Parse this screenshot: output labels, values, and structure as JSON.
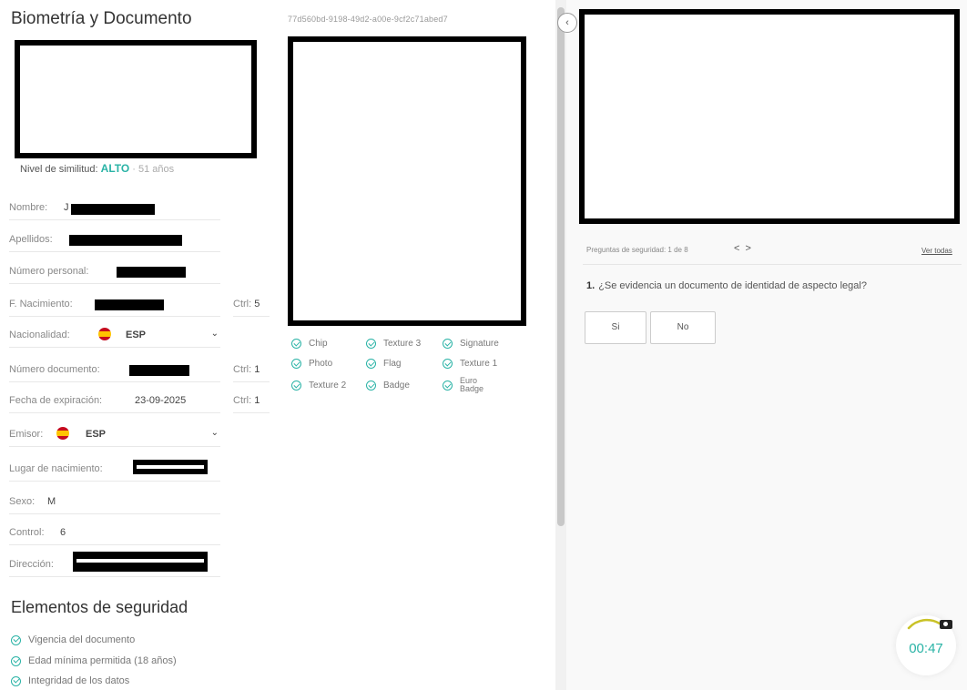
{
  "header": {
    "title": "Biometría y Documento",
    "document_id": "77d560bd-9198-49d2-a00e-9cf2c71abed7"
  },
  "biometry": {
    "similarity_label": "Nivel de similitud:",
    "similarity_level": "ALTO",
    "age": "· 51 años"
  },
  "fields": {
    "nombre_label": "Nombre:",
    "nombre_value": "J",
    "apellidos_label": "Apellidos:",
    "numero_personal_label": "Número personal:",
    "f_nacimiento_label": "F. Nacimiento:",
    "f_nacimiento_ctrl_label": "Ctrl:",
    "f_nacimiento_ctrl": "5",
    "nacionalidad_label": "Nacionalidad:",
    "nacionalidad_value": "ESP",
    "numero_documento_label": "Número documento:",
    "numero_documento_ctrl_label": "Ctrl:",
    "numero_documento_ctrl": "1",
    "fecha_expiracion_label": "Fecha de expiración:",
    "fecha_expiracion_value": "23-09-2025",
    "fecha_expiracion_ctrl_label": "Ctrl:",
    "fecha_expiracion_ctrl": "1",
    "emisor_label": "Emisor:",
    "emisor_value": "ESP",
    "lugar_nacimiento_label": "Lugar de nacimiento:",
    "sexo_label": "Sexo:",
    "sexo_value": "M",
    "control_label": "Control:",
    "control_value": "6",
    "direccion_label": "Dirección:"
  },
  "features": {
    "chip": "Chip",
    "texture3": "Texture 3",
    "signature": "Signature",
    "photo": "Photo",
    "flag": "Flag",
    "texture1": "Texture 1",
    "texture2": "Texture 2",
    "badge": "Badge",
    "euro_badge_1": "Euro",
    "euro_badge_2": "Badge"
  },
  "security": {
    "title": "Elementos de seguridad",
    "items": [
      "Vigencia del documento",
      "Edad mínima permitida (18 años)",
      "Integridad de los datos"
    ]
  },
  "questions": {
    "counter": "Preguntas de seguridad: 1 de 8",
    "prev": "<",
    "next": ">",
    "see_all": "Ver todas",
    "number": "1.",
    "text": "¿Se evidencia un documento de identidad de aspecto legal?",
    "yes": "Si",
    "no": "No"
  },
  "collapse": "‹",
  "timer": {
    "value": "00:47"
  },
  "colors": {
    "accent": "#2ab3a6"
  }
}
